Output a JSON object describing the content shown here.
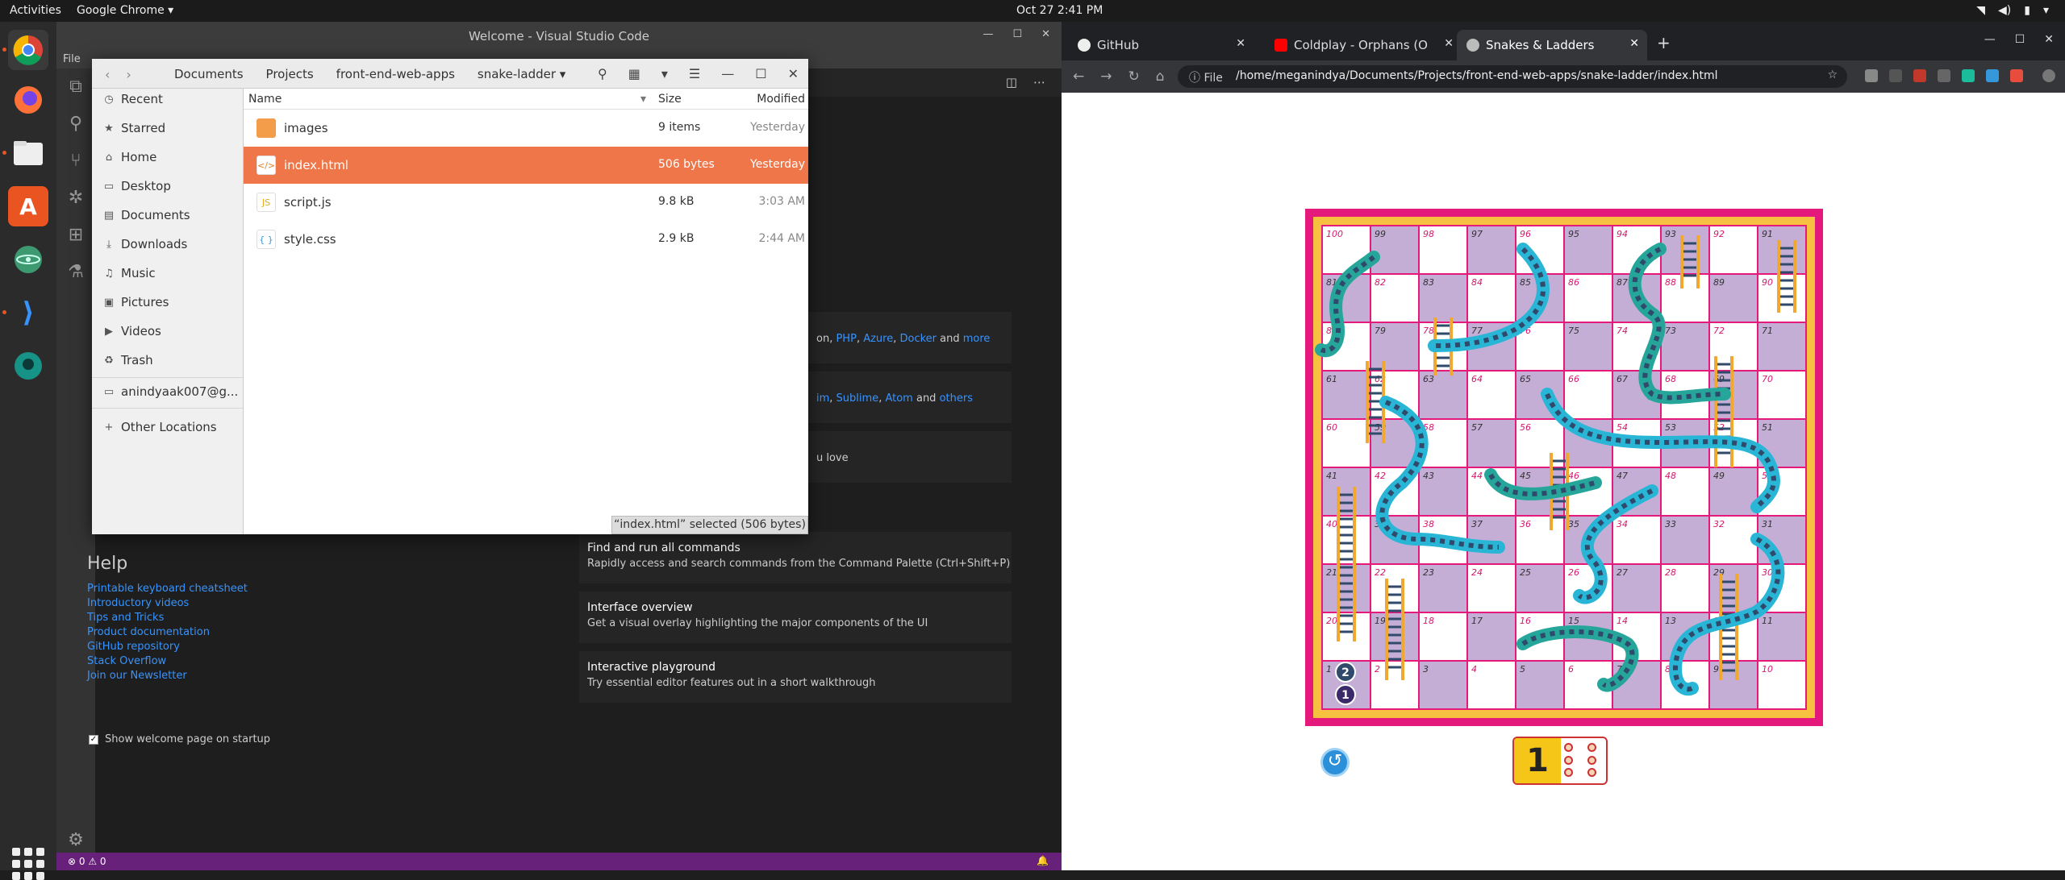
{
  "topbar": {
    "activities": "Activities",
    "app": "Google Chrome ▾",
    "clock": "Oct 27  2:41 PM"
  },
  "vscode": {
    "title": "Welcome - Visual Studio Code",
    "menu_file": "File",
    "help": {
      "heading": "Help",
      "links": [
        "Printable keyboard cheatsheet",
        "Introductory videos",
        "Tips and Tricks",
        "Product documentation",
        "GitHub repository",
        "Stack Overflow",
        "Join our Newsletter"
      ]
    },
    "show_welcome": "Show welcome page on startup",
    "partial_cards": [
      {
        "pre": "on, ",
        "links": [
          "PHP",
          "Azure",
          "Docker"
        ],
        "mid": " and ",
        "last": "more"
      },
      {
        "pre": "",
        "links": [
          "im",
          "Sublime",
          "Atom"
        ],
        "mid": " and ",
        "last": "others"
      },
      {
        "pre": "u love",
        "links": [],
        "mid": "",
        "last": ""
      }
    ],
    "cards": [
      {
        "title": "Find and run all commands",
        "desc": "Rapidly access and search commands from the Command Palette (Ctrl+Shift+P)"
      },
      {
        "title": "Interface overview",
        "desc": "Get a visual overlay highlighting the major components of the UI"
      },
      {
        "title": "Interactive playground",
        "desc": "Try essential editor features out in a short walkthrough"
      }
    ],
    "status_left": "⊗ 0 ⚠ 0"
  },
  "files": {
    "breadcrumbs": [
      "Documents",
      "Projects",
      "front-end-web-apps",
      "snake-ladder ▾"
    ],
    "sidebar": [
      {
        "icon": "clock-icon",
        "glyph": "◷",
        "label": "Recent"
      },
      {
        "icon": "star-icon",
        "glyph": "★",
        "label": "Starred"
      },
      {
        "icon": "home-icon",
        "glyph": "⌂",
        "label": "Home"
      },
      {
        "icon": "desktop-icon",
        "glyph": "▭",
        "label": "Desktop"
      },
      {
        "icon": "documents-icon",
        "glyph": "▤",
        "label": "Documents"
      },
      {
        "icon": "downloads-icon",
        "glyph": "⤓",
        "label": "Downloads"
      },
      {
        "icon": "music-icon",
        "glyph": "♫",
        "label": "Music"
      },
      {
        "icon": "pictures-icon",
        "glyph": "▣",
        "label": "Pictures"
      },
      {
        "icon": "videos-icon",
        "glyph": "▶",
        "label": "Videos"
      },
      {
        "icon": "trash-icon",
        "glyph": "🗑",
        "label": "Trash"
      }
    ],
    "account": "anindyaak007@g...",
    "other_locations": "Other Locations",
    "columns": {
      "name": "Name",
      "size": "Size",
      "modified": "Modified"
    },
    "rows": [
      {
        "name": "images",
        "size": "9 items",
        "modified": "Yesterday",
        "icon": "folder-icon"
      },
      {
        "name": "index.html",
        "size": "506 bytes",
        "modified": "Yesterday",
        "icon": "html-file-icon"
      },
      {
        "name": "script.js",
        "size": "9.8 kB",
        "modified": "3:03 AM",
        "icon": "js-file-icon"
      },
      {
        "name": "style.css",
        "size": "2.9 kB",
        "modified": "2:44 AM",
        "icon": "css-file-icon"
      }
    ],
    "selection_status": "“index.html” selected  (506 bytes)"
  },
  "chrome": {
    "tabs": [
      {
        "title": "GitHub",
        "color": "#eeeeee"
      },
      {
        "title": "Coldplay - Orphans (O",
        "color": "#ff0000"
      },
      {
        "title": "Snakes & Ladders",
        "color": "#bbbbbb"
      }
    ],
    "file_label": "File",
    "url": "/home/meganindya/Documents/Projects/front-end-web-apps/snake-ladder/index.html",
    "dice_value": "1",
    "board": {
      "cells_top_to_bottom": [
        [
          100,
          99,
          98,
          97,
          96,
          95,
          94,
          93,
          92,
          91
        ],
        [
          81,
          82,
          83,
          84,
          85,
          86,
          87,
          88,
          89,
          90
        ],
        [
          80,
          79,
          78,
          77,
          76,
          75,
          74,
          73,
          72,
          71
        ],
        [
          61,
          62,
          63,
          64,
          65,
          66,
          67,
          68,
          69,
          70
        ],
        [
          60,
          59,
          58,
          57,
          56,
          55,
          54,
          53,
          52,
          51
        ],
        [
          41,
          42,
          43,
          44,
          45,
          46,
          47,
          48,
          49,
          50
        ],
        [
          40,
          39,
          38,
          37,
          36,
          35,
          34,
          33,
          32,
          31
        ],
        [
          21,
          22,
          23,
          24,
          25,
          26,
          27,
          28,
          29,
          30
        ],
        [
          20,
          19,
          18,
          17,
          16,
          15,
          14,
          13,
          12,
          11
        ],
        [
          1,
          2,
          3,
          4,
          5,
          6,
          7,
          8,
          9,
          10
        ]
      ],
      "tokens": [
        "2",
        "1"
      ],
      "colors": {
        "frame": "#e5197c",
        "light": "#ffffff",
        "dark": "#c4aed6",
        "number": "#d6186e"
      }
    }
  }
}
